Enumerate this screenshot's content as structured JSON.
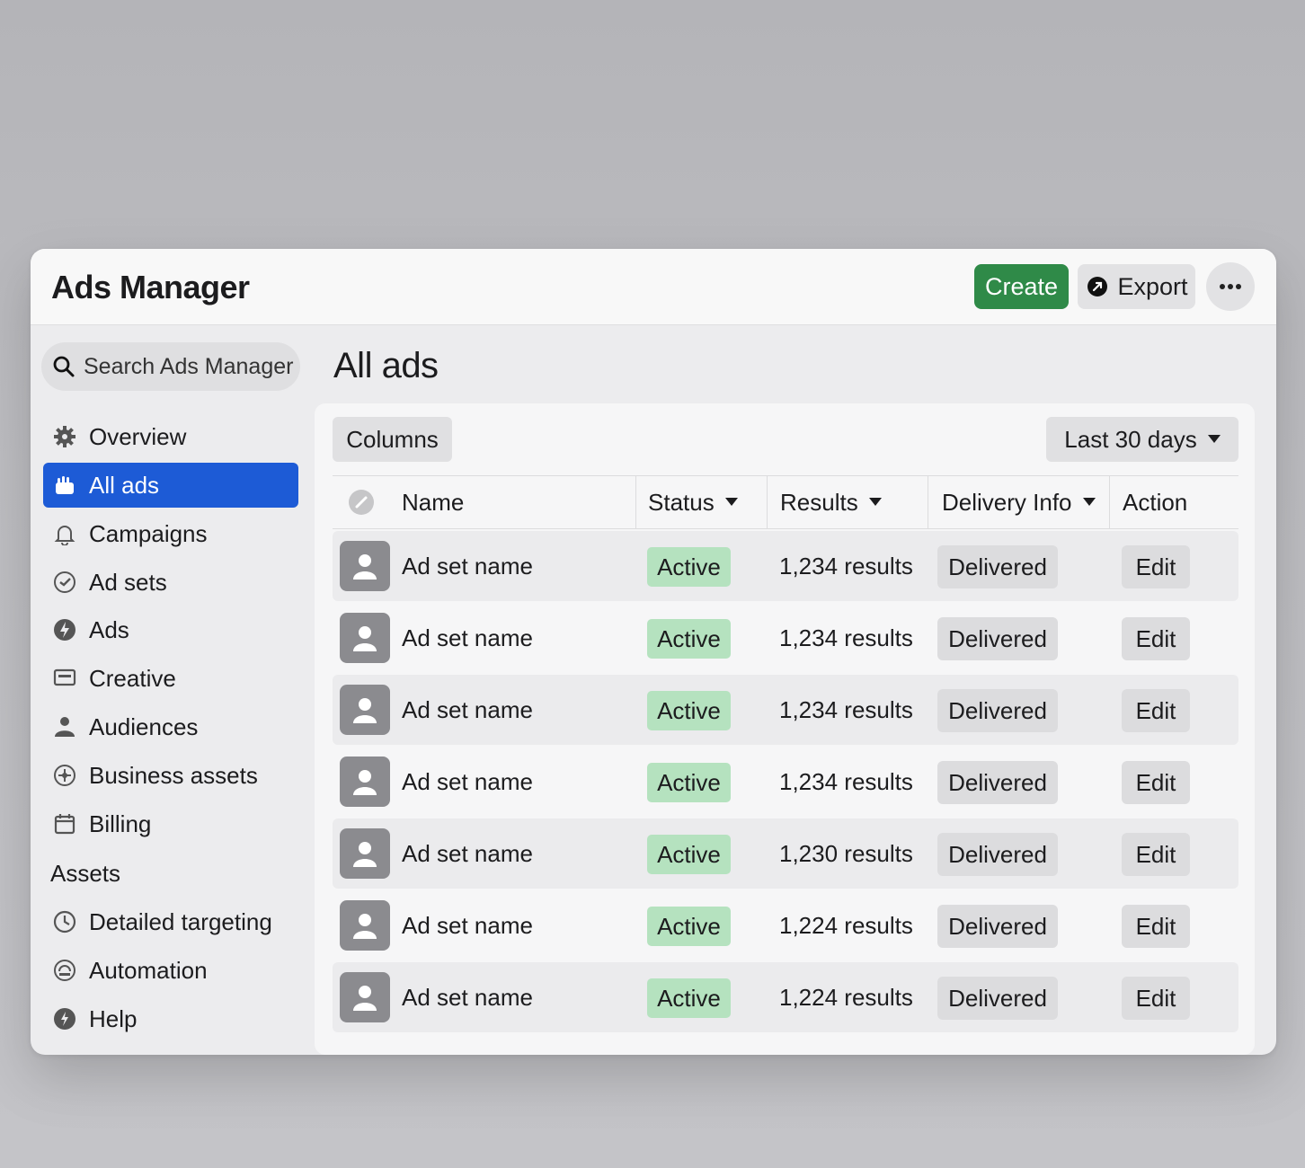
{
  "app": {
    "title": "Ads Manager",
    "create_label": "Create",
    "export_label": "Export",
    "more_label": "•••"
  },
  "search": {
    "placeholder": "Search Ads Manager"
  },
  "sidebar": {
    "items": [
      {
        "label": "Overview",
        "icon": "gear-icon"
      },
      {
        "label": "All ads",
        "icon": "hand-icon",
        "active": true
      },
      {
        "label": "Campaigns",
        "icon": "bell-icon"
      },
      {
        "label": "Ad sets",
        "icon": "check-circle-icon"
      },
      {
        "label": "Ads",
        "icon": "bolt-icon"
      },
      {
        "label": "Creative",
        "icon": "monitor-icon"
      },
      {
        "label": "Audiences",
        "icon": "people-icon"
      },
      {
        "label": "Business assets",
        "icon": "compass-icon"
      },
      {
        "label": "Billing",
        "icon": "calendar-icon"
      }
    ],
    "assets_heading": "Assets",
    "asset_items": [
      {
        "label": "Detailed targeting",
        "icon": "clock-icon"
      },
      {
        "label": "Automation",
        "icon": "automation-icon"
      },
      {
        "label": "Help",
        "icon": "help-icon"
      }
    ]
  },
  "main": {
    "title": "All ads",
    "columns_label": "Columns",
    "date_range": "Last 30 days",
    "headers": {
      "name": "Name",
      "status": "Status",
      "results": "Results",
      "delivery": "Delivery Info",
      "action": "Action"
    },
    "rows": [
      {
        "name": "Ad set name",
        "status": "Active",
        "results": "1,234 results",
        "delivery": "Delivered",
        "action": "Edit"
      },
      {
        "name": "Ad set name",
        "status": "Active",
        "results": "1,234 results",
        "delivery": "Delivered",
        "action": "Edit"
      },
      {
        "name": "Ad set name",
        "status": "Active",
        "results": "1,234 results",
        "delivery": "Delivered",
        "action": "Edit"
      },
      {
        "name": "Ad set name",
        "status": "Active",
        "results": "1,234 results",
        "delivery": "Delivered",
        "action": "Edit"
      },
      {
        "name": "Ad set name",
        "status": "Active",
        "results": "1,230 results",
        "delivery": "Delivered",
        "action": "Edit"
      },
      {
        "name": "Ad set name",
        "status": "Active",
        "results": "1,224 results",
        "delivery": "Delivered",
        "action": "Edit"
      },
      {
        "name": "Ad set name",
        "status": "Active",
        "results": "1,224 results",
        "delivery": "Delivered",
        "action": "Edit"
      }
    ]
  },
  "colors": {
    "accent_blue": "#1d5bd6",
    "create_green": "#2f8a48",
    "active_badge": "#b5e2bf"
  }
}
